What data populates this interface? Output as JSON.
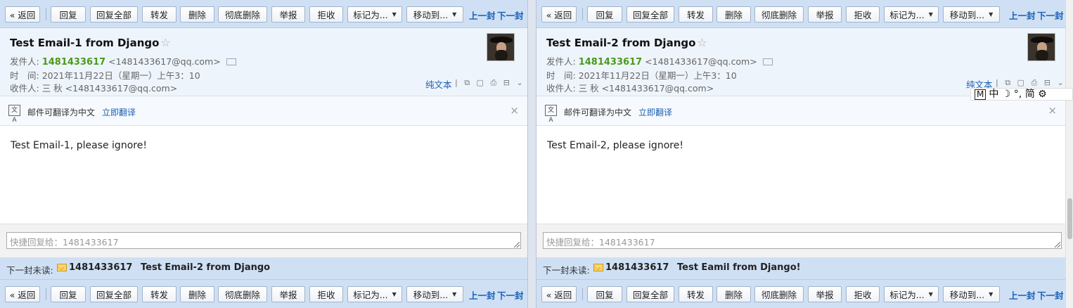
{
  "toolbar": {
    "back": "« 返回",
    "reply": "回复",
    "reply_all": "回复全部",
    "forward": "转发",
    "delete": "删除",
    "delete_forever": "彻底删除",
    "report": "举报",
    "reject": "拒收",
    "mark_as": "标记为...",
    "move_to": "移动到...",
    "prev": "上一封",
    "next": "下一封"
  },
  "emails": [
    {
      "subject": "Test Email-1 from Django",
      "star": "☆",
      "from_label": "发件人:",
      "from_name": "1481433617",
      "from_address": "<1481433617@qq.com>",
      "time_label": "时　间:",
      "time_value": "2021年11月22日（星期一）上午3：10",
      "to_label": "收件人:",
      "to_value": "三 秋 <1481433617@qq.com>",
      "plain_text": "纯文本",
      "translate_text": "邮件可翻译为中文",
      "translate_link": "立即翻译",
      "close": "×",
      "body": "Test Email-1, please ignore!",
      "quick_reply_placeholder": "快捷回复给：1481433617",
      "next_unread_label": "下一封未读:",
      "next_unread_sender": "1481433617",
      "next_unread_subject": "Test Email-2 from Django"
    },
    {
      "subject": "Test Email-2 from Django",
      "star": "☆",
      "from_label": "发件人:",
      "from_name": "1481433617",
      "from_address": "<1481433617@qq.com>",
      "time_label": "时　间:",
      "time_value": "2021年11月22日（星期一）上午3：10",
      "to_label": "收件人:",
      "to_value": "三 秋 <1481433617@qq.com>",
      "plain_text": "纯文本",
      "translate_text": "邮件可翻译为中文",
      "translate_link": "立即翻译",
      "close": "×",
      "body": "Test Email-2, please ignore!",
      "quick_reply_placeholder": "快捷回复给：1481433617",
      "next_unread_label": "下一封未读:",
      "next_unread_sender": "1481433617",
      "next_unread_subject": "Test Eamil from Django!"
    }
  ],
  "ime": {
    "m": "M",
    "chars": "中 ☽ °, 简 ⚙"
  },
  "colors": {
    "toolbar_bg": "#cfe0f4",
    "link": "#1a5fb4",
    "sender_green": "#4a9a1a"
  }
}
